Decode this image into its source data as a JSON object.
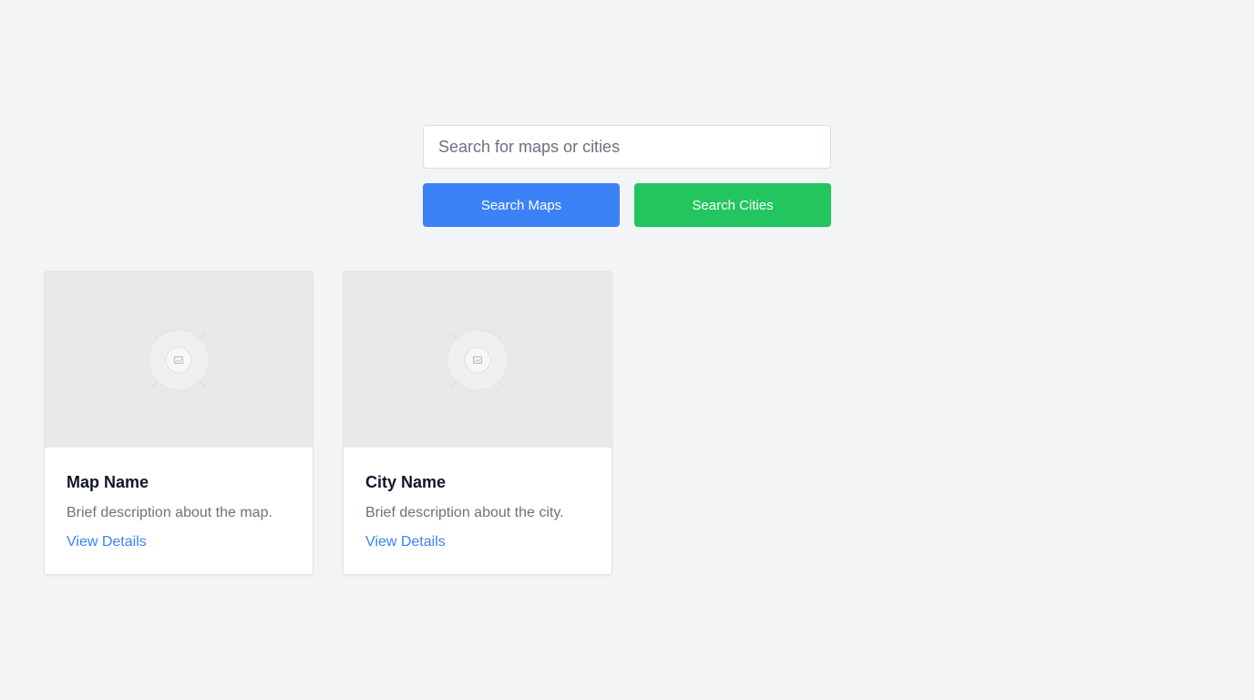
{
  "search": {
    "placeholder": "Search for maps or cities",
    "value": "",
    "maps_button_label": "Search Maps",
    "cities_button_label": "Search Cities"
  },
  "cards": [
    {
      "title": "Map Name",
      "description": "Brief description about the map.",
      "link_label": "View Details",
      "image_icon": "image-placeholder-icon"
    },
    {
      "title": "City Name",
      "description": "Brief description about the city.",
      "link_label": "View Details",
      "image_icon": "image-placeholder-icon"
    }
  ],
  "colors": {
    "background": "#f3f4f6",
    "maps_button": "#3b82f6",
    "cities_button": "#22c55e",
    "link": "#3b82f6"
  }
}
